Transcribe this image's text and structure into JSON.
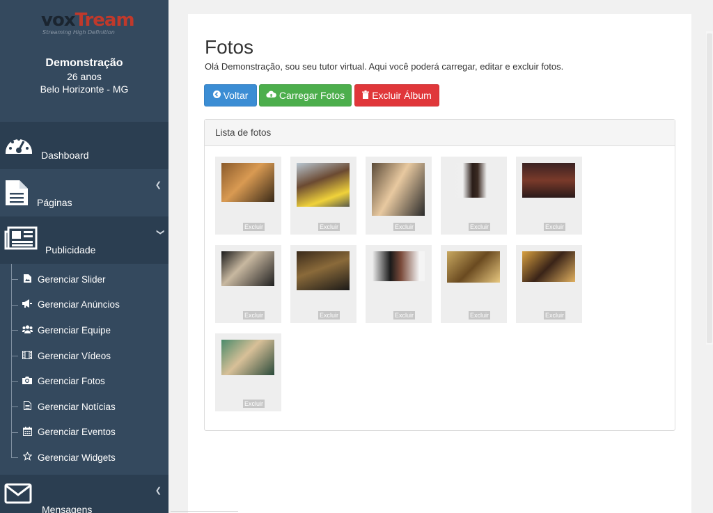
{
  "brand": {
    "logo_text_1": "vox",
    "logo_text_2": "Tream",
    "logo_tagline": "Streaming High Definition"
  },
  "profile": {
    "name": "Demonstração",
    "age": "26 anos",
    "location": "Belo Horizonte - MG"
  },
  "menu": {
    "dashboard": "Dashboard",
    "paginas": "Páginas",
    "publicidade": "Publicidade",
    "mensagens": "Mensagens",
    "submenu": [
      {
        "label": "Gerenciar Slider",
        "icon": "image-icon"
      },
      {
        "label": "Gerenciar Anúncios",
        "icon": "bullhorn-icon"
      },
      {
        "label": "Gerenciar Equipe",
        "icon": "users-icon"
      },
      {
        "label": "Gerenciar Vídeos",
        "icon": "film-icon"
      },
      {
        "label": "Gerenciar Fotos",
        "icon": "camera-icon"
      },
      {
        "label": "Gerenciar Notícias",
        "icon": "file-icon"
      },
      {
        "label": "Gerenciar Eventos",
        "icon": "calendar-icon"
      },
      {
        "label": "Gerenciar Widgets",
        "icon": "star-icon"
      }
    ]
  },
  "page": {
    "title": "Fotos",
    "description": "Olá Demonstração, sou seu tutor virtual. Aqui você poderá carregar, editar e excluir fotos.",
    "buttons": {
      "voltar": "Voltar",
      "carregar": "Carregar Fotos",
      "excluir_album": "Excluir Álbum"
    },
    "panel_title": "Lista de fotos",
    "photos": [
      {
        "delete_label": "Excluir"
      },
      {
        "delete_label": "Excluir"
      },
      {
        "delete_label": "Excluir"
      },
      {
        "delete_label": "Excluir"
      },
      {
        "delete_label": "Excluir"
      },
      {
        "delete_label": "Excluir"
      },
      {
        "delete_label": "Excluir"
      },
      {
        "delete_label": "Excluir"
      },
      {
        "delete_label": "Excluir"
      },
      {
        "delete_label": "Excluir"
      },
      {
        "delete_label": "Excluir"
      }
    ]
  },
  "colors": {
    "sidebar": "#2e4256",
    "primary": "#3b8dd4",
    "success": "#4cae4c",
    "danger": "#e0373a"
  }
}
